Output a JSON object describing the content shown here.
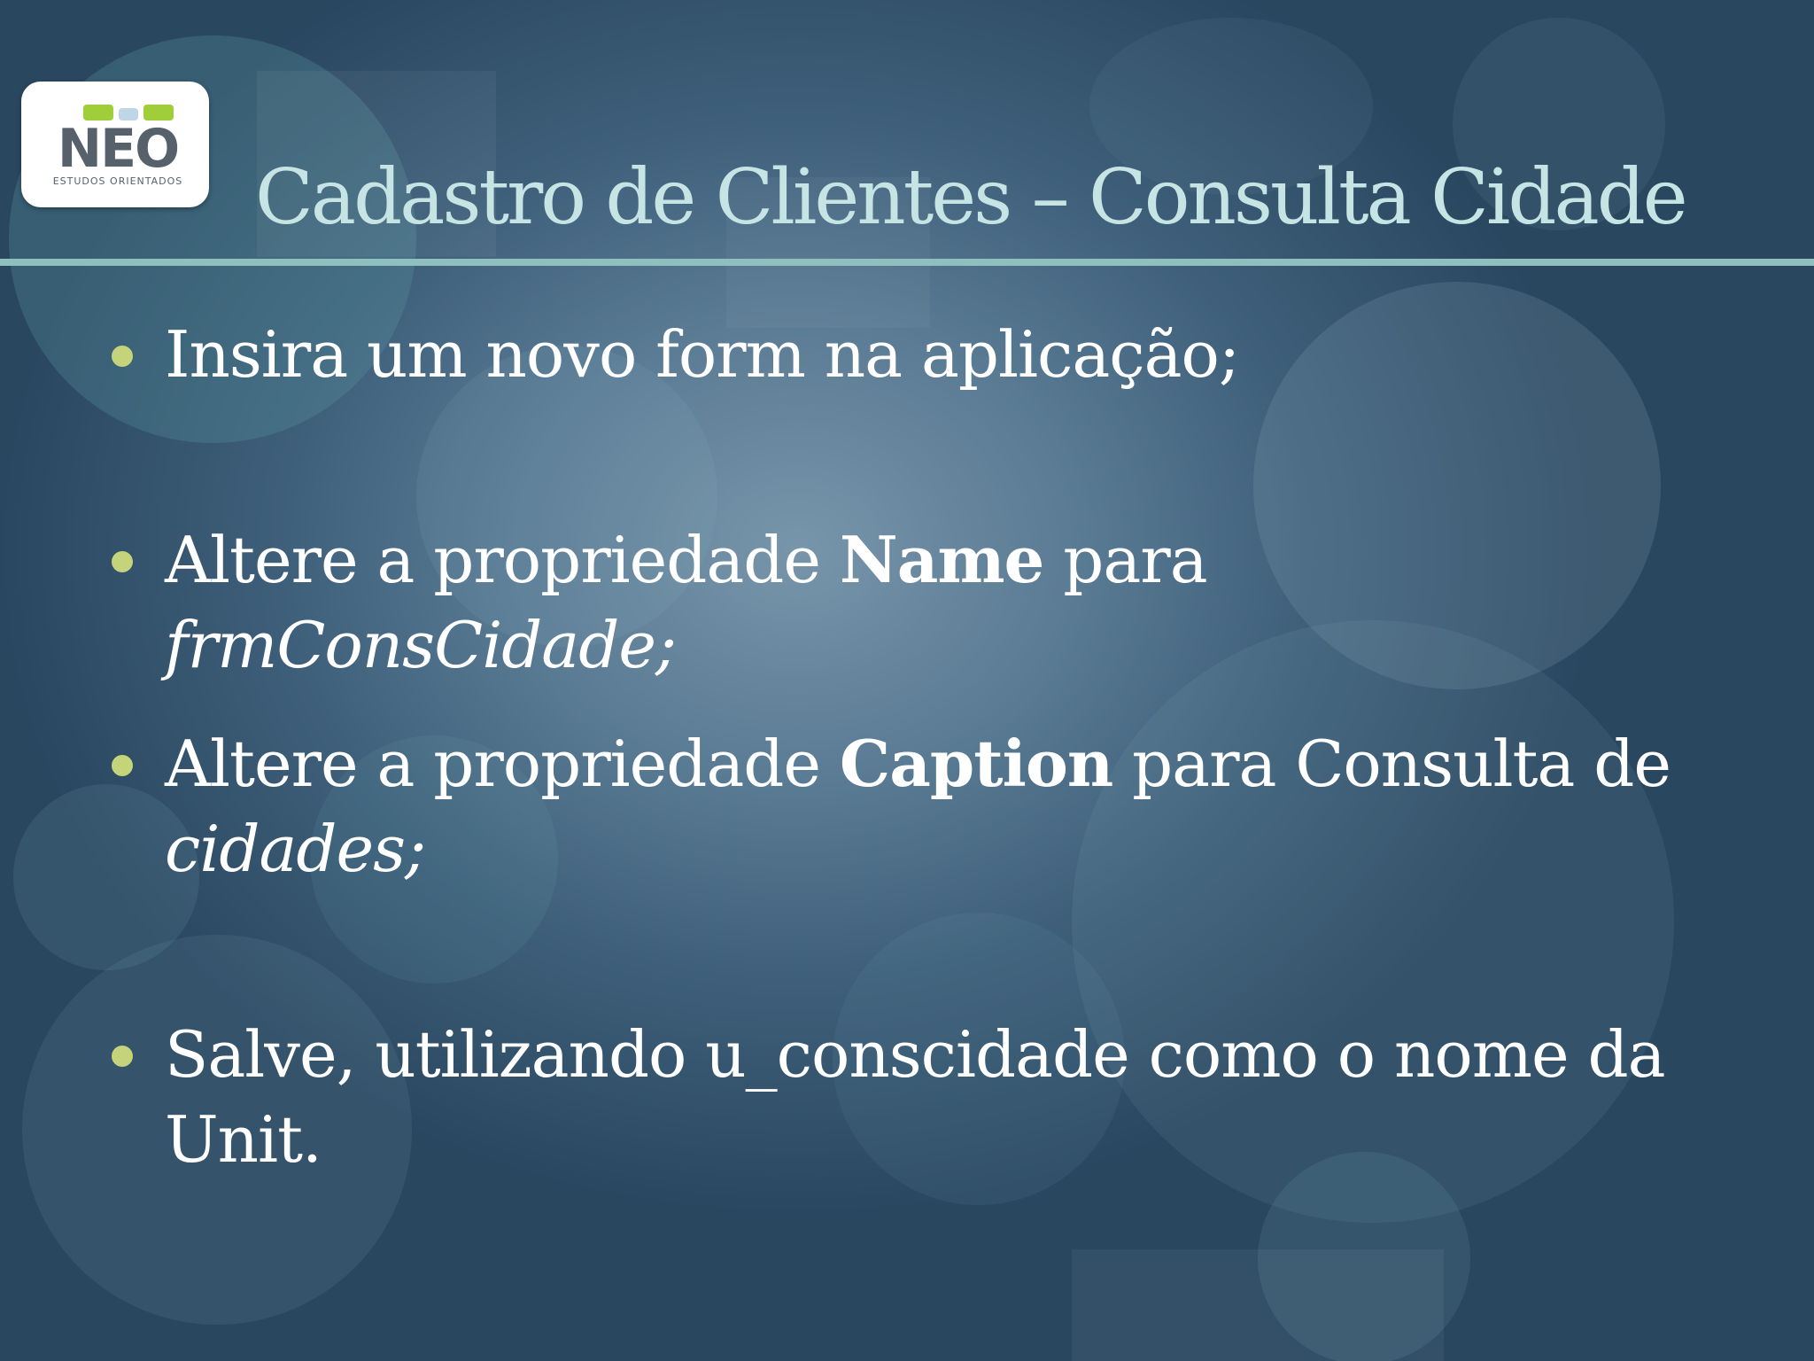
{
  "logo": {
    "word": "NEO",
    "tagline": "ESTUDOS ORIENTADOS"
  },
  "title": "Cadastro de Clientes – Consulta Cidade",
  "bullets": [
    {
      "text": "Insira um novo form na aplicação;"
    },
    {
      "pre": "Altere a propriedade ",
      "strong": "Name",
      "mid": " para ",
      "em": "frmConsCidade;"
    },
    {
      "pre": "Altere a propriedade ",
      "strong": "Caption",
      "mid": " para Consulta de ",
      "em": "cidades;"
    },
    {
      "text": "Salve, utilizando u_conscidade como o nome da Unit."
    }
  ],
  "colors": {
    "title": "#c7e4e4",
    "divider": "#8fc0bf",
    "bullet_dot": "#c5d37a",
    "text": "#ffffff"
  }
}
